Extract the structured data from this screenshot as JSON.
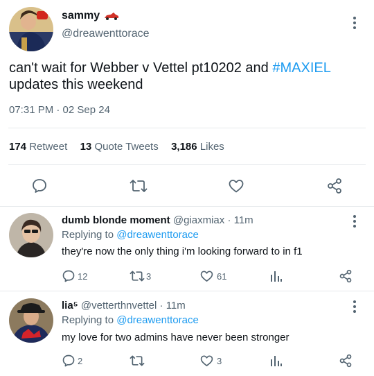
{
  "tweet": {
    "display_name": "sammy",
    "handle": "@dreawenttorace",
    "text_before": "can't wait for Webber v Vettel pt10202 and ",
    "hashtag": "#MAXIEL",
    "text_after": " updates this weekend",
    "timestamp": "07:31 PM · 02 Sep 24",
    "retweet_count": "174",
    "retweet_label": "Retweet",
    "quote_count": "13",
    "quote_label": "Quote Tweets",
    "like_count": "3,186",
    "like_label": "Likes"
  },
  "replies": [
    {
      "display_name": "dumb blonde moment",
      "handle": "@giaxmiax",
      "time": "· 11m",
      "replying_prefix": "Replying to ",
      "replying_to": "@dreawenttorace",
      "text": "they're now the only thing i'm looking forward to in f1",
      "reply_count": "12",
      "retweet_count": "3",
      "like_count": "61"
    },
    {
      "display_name": "lia⁵",
      "handle": "@vetterthnvettel",
      "time": "· 11m",
      "replying_prefix": "Replying to ",
      "replying_to": "@dreawenttorace",
      "text": "my love for two admins have never been stronger",
      "reply_count": "2",
      "retweet_count": "",
      "like_count": "3"
    }
  ],
  "colors": {
    "accent": "#1d9bf0",
    "text": "#0f1419",
    "muted": "#536471",
    "divider": "#e6e9ec"
  }
}
